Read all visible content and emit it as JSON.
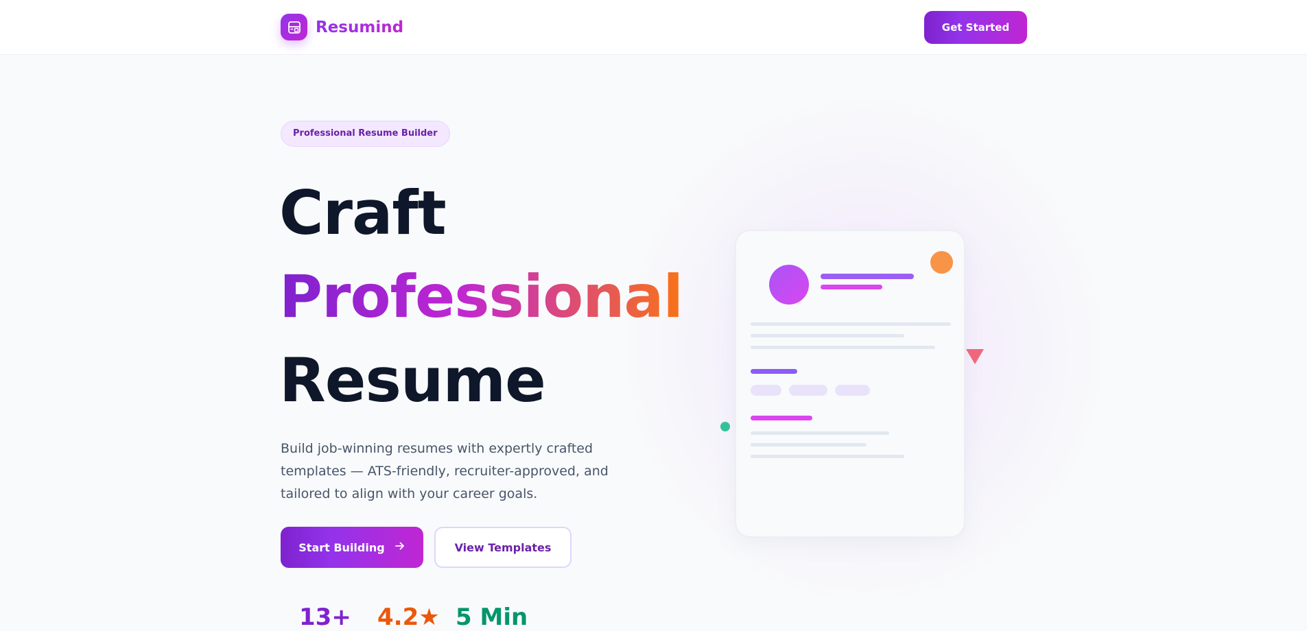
{
  "nav": {
    "brand_name": "Resumind",
    "cta_label": "Get Started"
  },
  "hero": {
    "badge": "Professional Resume Builder",
    "headline_line1": "Craft",
    "headline_line2": "Professional",
    "headline_line3": "Resume",
    "description": "Build job-winning resumes with expertly crafted templates — ATS-friendly, recruiter-approved, and tailored to align with your career goals.",
    "primary_button": "Start Building",
    "secondary_button": "View Templates"
  },
  "stats": [
    {
      "value": "13+"
    },
    {
      "value": "4.2★"
    },
    {
      "value": "5 Min"
    }
  ],
  "colors": {
    "brand_purple": "#9333ea",
    "brand_magenta": "#c026d3",
    "accent_orange": "#f97316",
    "stat_purple": "#7e22ce",
    "stat_orange": "#ea580c",
    "stat_green": "#059669",
    "heading_dark": "#0f172a"
  },
  "icons": {
    "brand_logo": "layout-template-icon",
    "primary_button_icon": "arrow-right-icon"
  }
}
